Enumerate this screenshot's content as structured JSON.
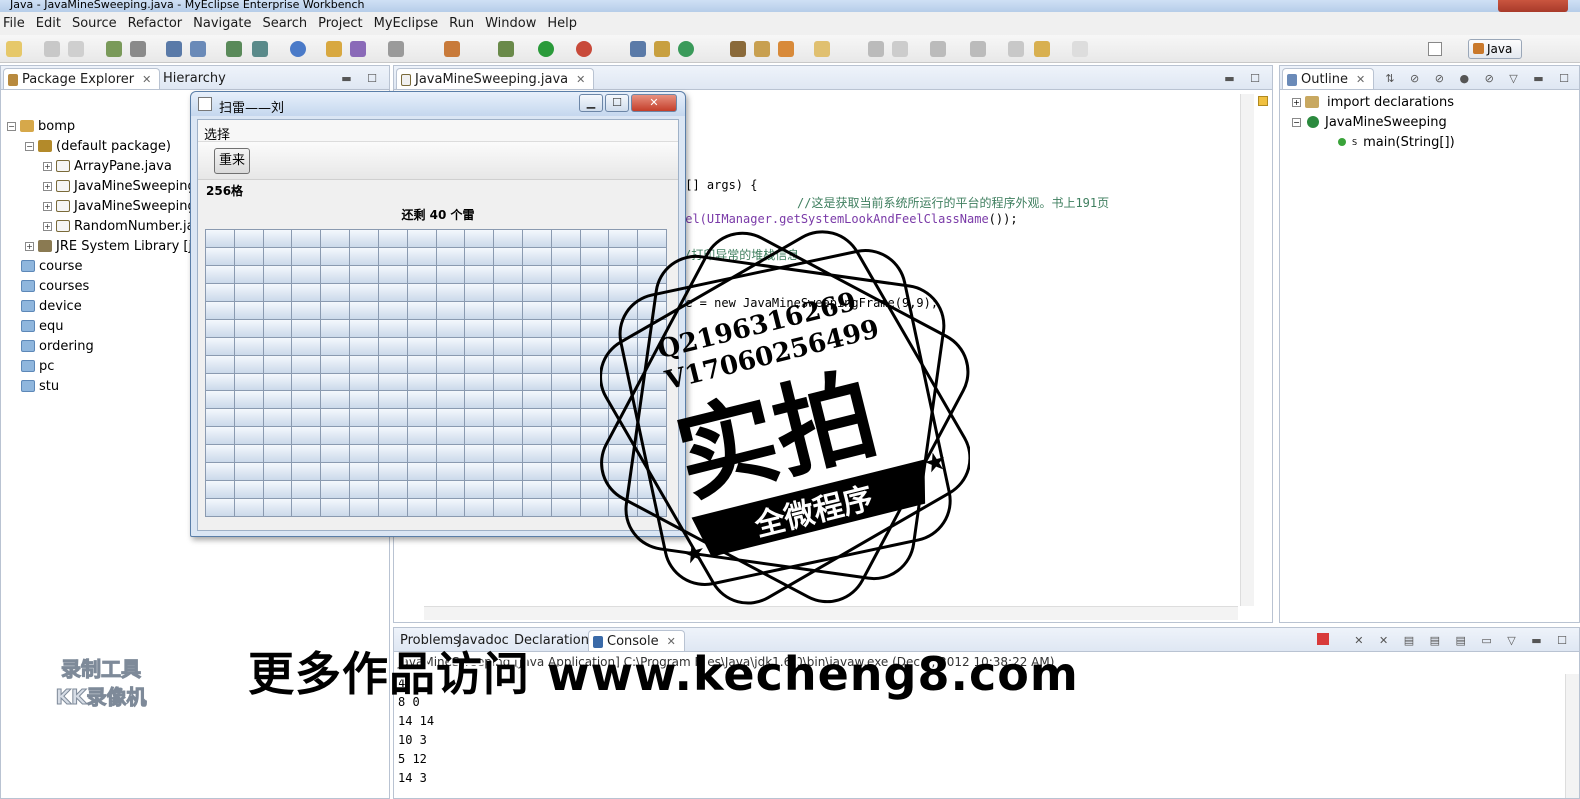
{
  "window_title": "Java - JavaMineSweeping.java - MyEclipse Enterprise Workbench",
  "menu": [
    "File",
    "Edit",
    "Source",
    "Refactor",
    "Navigate",
    "Search",
    "Project",
    "MyEclipse",
    "Run",
    "Window",
    "Help"
  ],
  "perspective": "Java",
  "left_panel": {
    "tabs": [
      {
        "label": "Package Explorer",
        "active": true
      },
      {
        "label": "Hierarchy",
        "active": false
      }
    ],
    "tree": [
      {
        "label": "bomp",
        "level": 0,
        "icon": "project-icon",
        "expanded": true
      },
      {
        "label": "(default package)",
        "level": 1,
        "icon": "package-icon",
        "expanded": true
      },
      {
        "label": "ArrayPane.java",
        "level": 2,
        "icon": "java-file-icon"
      },
      {
        "label": "JavaMineSweeping",
        "level": 2,
        "icon": "java-file-icon"
      },
      {
        "label": "JavaMineSweeping",
        "level": 2,
        "icon": "java-file-icon"
      },
      {
        "label": "RandomNumber.ja",
        "level": 2,
        "icon": "java-file-icon"
      },
      {
        "label": "JRE System Library [jdl",
        "level": 1,
        "icon": "library-icon"
      },
      {
        "label": "course",
        "level": 0,
        "icon": "folder-icon"
      },
      {
        "label": "courses",
        "level": 0,
        "icon": "folder-icon"
      },
      {
        "label": "device",
        "level": 0,
        "icon": "folder-icon"
      },
      {
        "label": "equ",
        "level": 0,
        "icon": "folder-icon"
      },
      {
        "label": "ordering",
        "level": 0,
        "icon": "folder-icon"
      },
      {
        "label": "pc",
        "level": 0,
        "icon": "folder-icon"
      },
      {
        "label": "stu",
        "level": 0,
        "icon": "folder-icon"
      }
    ]
  },
  "editor": {
    "tab": "JavaMineSweeping.java",
    "lines": {
      "l1": "g[] args) {",
      "l2": "//这是获取当前系统所运行的平台的程序外观。书上191页",
      "l3_a": "eel(",
      "l3_b": "UIManager.getSystemLookAndFeelClassName",
      "l3_c": "());",
      "l4": "/打印异常的堆栈信息",
      "l5": "me = new JavaMineSweepingFrame(9,9);"
    }
  },
  "outline": {
    "tab": "Outline",
    "items": [
      {
        "label": "import declarations",
        "icon": "imports-icon"
      },
      {
        "label": "JavaMineSweeping",
        "icon": "class-icon"
      },
      {
        "label": "main(String[])",
        "icon": "method-icon",
        "modifier": "S"
      }
    ]
  },
  "bottom_panel": {
    "tabs": [
      "Problems",
      "Javadoc",
      "Declaration",
      "Console"
    ],
    "active_tab": "Console",
    "console_header": "JavaMineSweeping [Java Application] C:\\Program Files\\Java\\jdk1.6.0\\bin\\javaw.exe (Dec 9, 2012 10:38:22 AM)",
    "console_lines": [
      "4",
      "8 0",
      "14 14",
      "10 3",
      "5 12",
      "14 3"
    ]
  },
  "swing_window": {
    "title": "扫雷——刘",
    "menu_label": "选择",
    "restart_button": "重来",
    "grid_count_label": "256格",
    "remaining_label": "还剩  40  个雷",
    "rows": 16,
    "cols": 16
  },
  "watermarks": {
    "stamp_line1": "Q2196316269",
    "stamp_line2": "V17060256499",
    "stamp_big": "实拍",
    "stamp_banner": "全微程序",
    "overlay_text": "更多作品访问 www.kecheng8.com",
    "recorder_line1": "录制工具",
    "recorder_line2": "KK录像机"
  },
  "colors": {
    "keyword": "#7f0055",
    "comment": "#3f7f5f",
    "method": "#7a3aa8",
    "panel_border": "#b9c3d2"
  }
}
